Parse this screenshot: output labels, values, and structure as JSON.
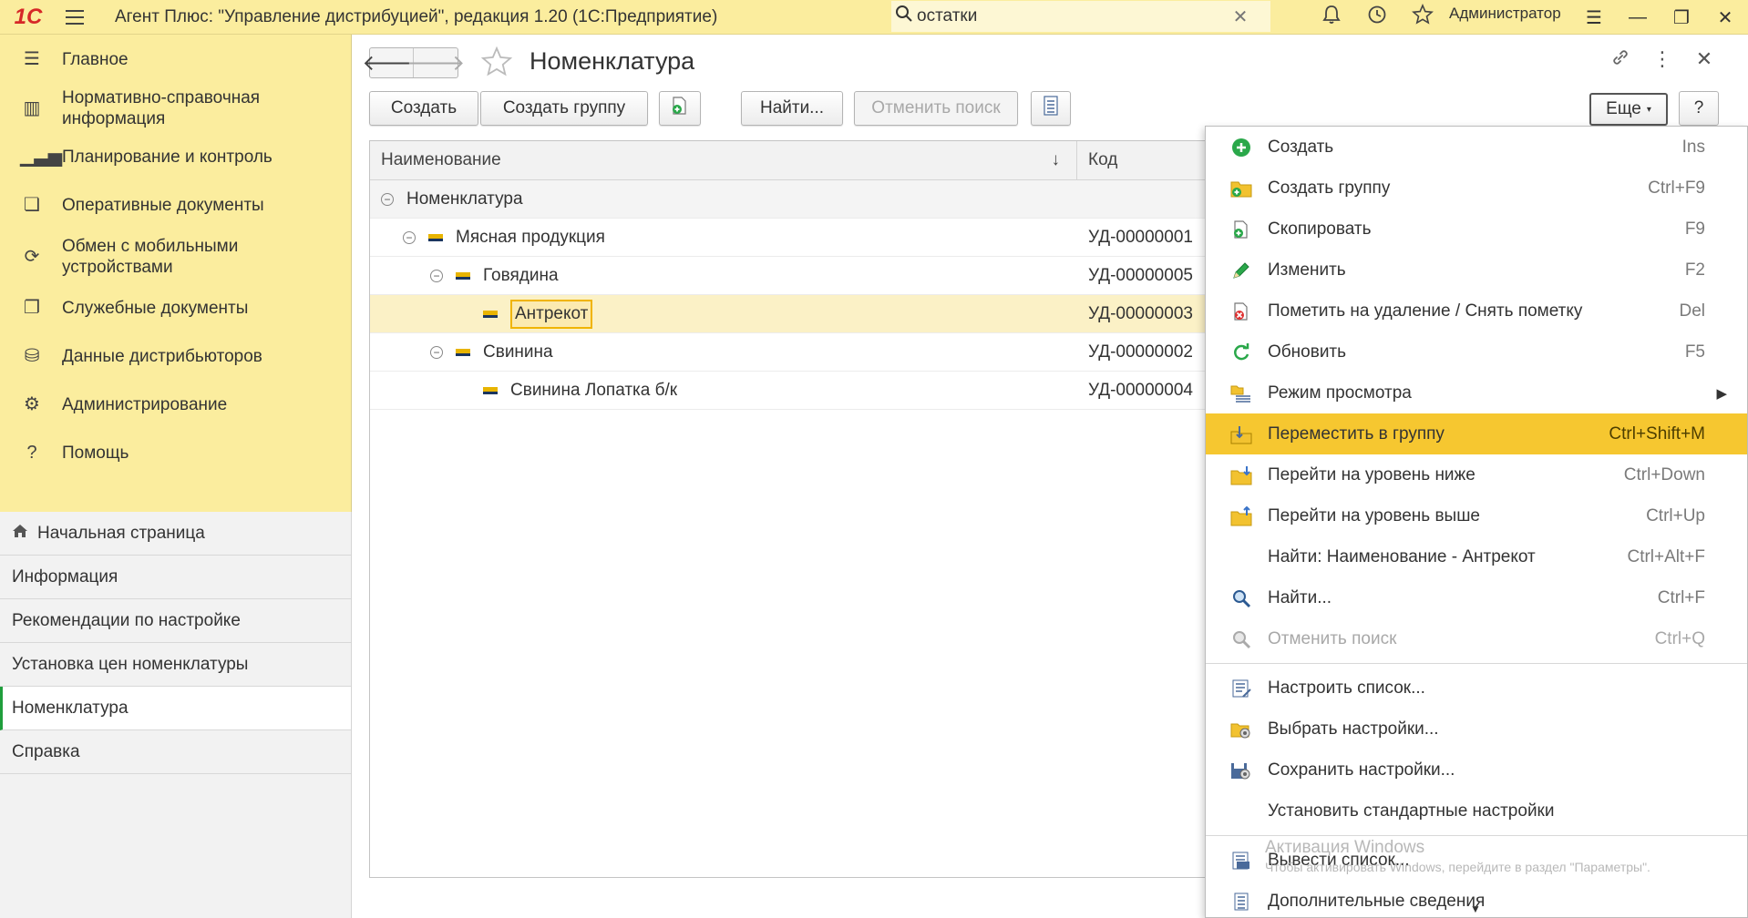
{
  "app": {
    "logo": "1C",
    "title": "Агент Плюс: \"Управление дистрибуцией\", редакция 1.20  (1С:Предприятие)",
    "search_value": "остатки",
    "user": "Администратор"
  },
  "sidebar": {
    "items": [
      {
        "label": "Главное",
        "icon": "menu-lines-icon"
      },
      {
        "label": "Нормативно-справочная информация",
        "icon": "bars-icon"
      },
      {
        "label": "Планирование и контроль",
        "icon": "chart-icon"
      },
      {
        "label": "Оперативные документы",
        "icon": "documents-icon"
      },
      {
        "label": "Обмен с мобильными устройствами",
        "icon": "sync-icon"
      },
      {
        "label": "Служебные документы",
        "icon": "service-docs-icon"
      },
      {
        "label": "Данные дистрибьюторов",
        "icon": "distributor-icon"
      },
      {
        "label": "Администрирование",
        "icon": "gear-icon"
      },
      {
        "label": "Помощь",
        "icon": "question-icon"
      }
    ]
  },
  "open_windows": [
    {
      "label": "Начальная страница",
      "icon": "home-icon"
    },
    {
      "label": "Информация"
    },
    {
      "label": "Рекомендации по настройке"
    },
    {
      "label": "Установка цен номенклатуры"
    },
    {
      "label": "Номенклатура",
      "active": true
    },
    {
      "label": "Справка"
    }
  ],
  "form": {
    "title": "Номенклатура",
    "toolbar": {
      "create": "Создать",
      "create_group": "Создать группу",
      "find": "Найти...",
      "cancel_search": "Отменить поиск",
      "more": "Еще",
      "help": "?"
    },
    "table": {
      "columns": {
        "name": "Наименование",
        "code": "Код",
        "sort_mark": "↓"
      },
      "rows": [
        {
          "name": "Номенклатура",
          "code": ""
        },
        {
          "name": "Мясная продукция",
          "code": "УД-00000001"
        },
        {
          "name": "Говядина",
          "code": "УД-00000005"
        },
        {
          "name": "Антрекот",
          "code": "УД-00000003"
        },
        {
          "name": "Свинина",
          "code": "УД-00000002"
        },
        {
          "name": "Свинина Лопатка б/к",
          "code": "УД-00000004"
        }
      ]
    }
  },
  "menu": {
    "items": [
      {
        "label": "Создать",
        "shortcut": "Ins",
        "icon": "plus-circle-icon"
      },
      {
        "label": "Создать группу",
        "shortcut": "Ctrl+F9",
        "icon": "add-folder-icon"
      },
      {
        "label": "Скопировать",
        "shortcut": "F9",
        "icon": "copy-icon"
      },
      {
        "label": "Изменить",
        "shortcut": "F2",
        "icon": "pencil-icon"
      },
      {
        "label": "Пометить на удаление / Снять пометку",
        "shortcut": "Del",
        "icon": "delete-mark-icon"
      },
      {
        "label": "Обновить",
        "shortcut": "F5",
        "icon": "refresh-icon"
      },
      {
        "label": "Режим просмотра",
        "shortcut": "",
        "icon": "view-mode-icon"
      },
      {
        "label": "Переместить в группу",
        "shortcut": "Ctrl+Shift+M",
        "icon": "move-to-group-icon"
      },
      {
        "label": "Перейти на уровень ниже",
        "shortcut": "Ctrl+Down",
        "icon": "level-down-icon"
      },
      {
        "label": "Перейти на уровень выше",
        "shortcut": "Ctrl+Up",
        "icon": "level-up-icon"
      },
      {
        "label": "Найти: Наименование - Антрекот",
        "shortcut": "Ctrl+Alt+F",
        "icon": ""
      },
      {
        "label": "Найти...",
        "shortcut": "Ctrl+F",
        "icon": "search-icon"
      },
      {
        "label": "Отменить поиск",
        "shortcut": "Ctrl+Q",
        "icon": "cancel-search-icon"
      },
      {
        "label": "Настроить список...",
        "shortcut": "",
        "icon": "list-settings-icon"
      },
      {
        "label": "Выбрать настройки...",
        "shortcut": "",
        "icon": "choose-settings-icon"
      },
      {
        "label": "Сохранить настройки...",
        "shortcut": "",
        "icon": "save-settings-icon"
      },
      {
        "label": "Установить стандартные настройки",
        "shortcut": "",
        "icon": ""
      },
      {
        "label": "Вывести список...",
        "shortcut": "",
        "icon": "print-list-icon"
      },
      {
        "label": "Дополнительные сведения",
        "shortcut": "",
        "icon": "info-list-icon"
      }
    ]
  },
  "watermark": {
    "line1": "Активация Windows",
    "line2": "Чтобы активировать Windows, перейдите в раздел \"Параметры\"."
  },
  "colors": {
    "accent_yellow": "#fbed9e",
    "highlight": "#f6c730",
    "active_marker": "#1f9e3c"
  }
}
